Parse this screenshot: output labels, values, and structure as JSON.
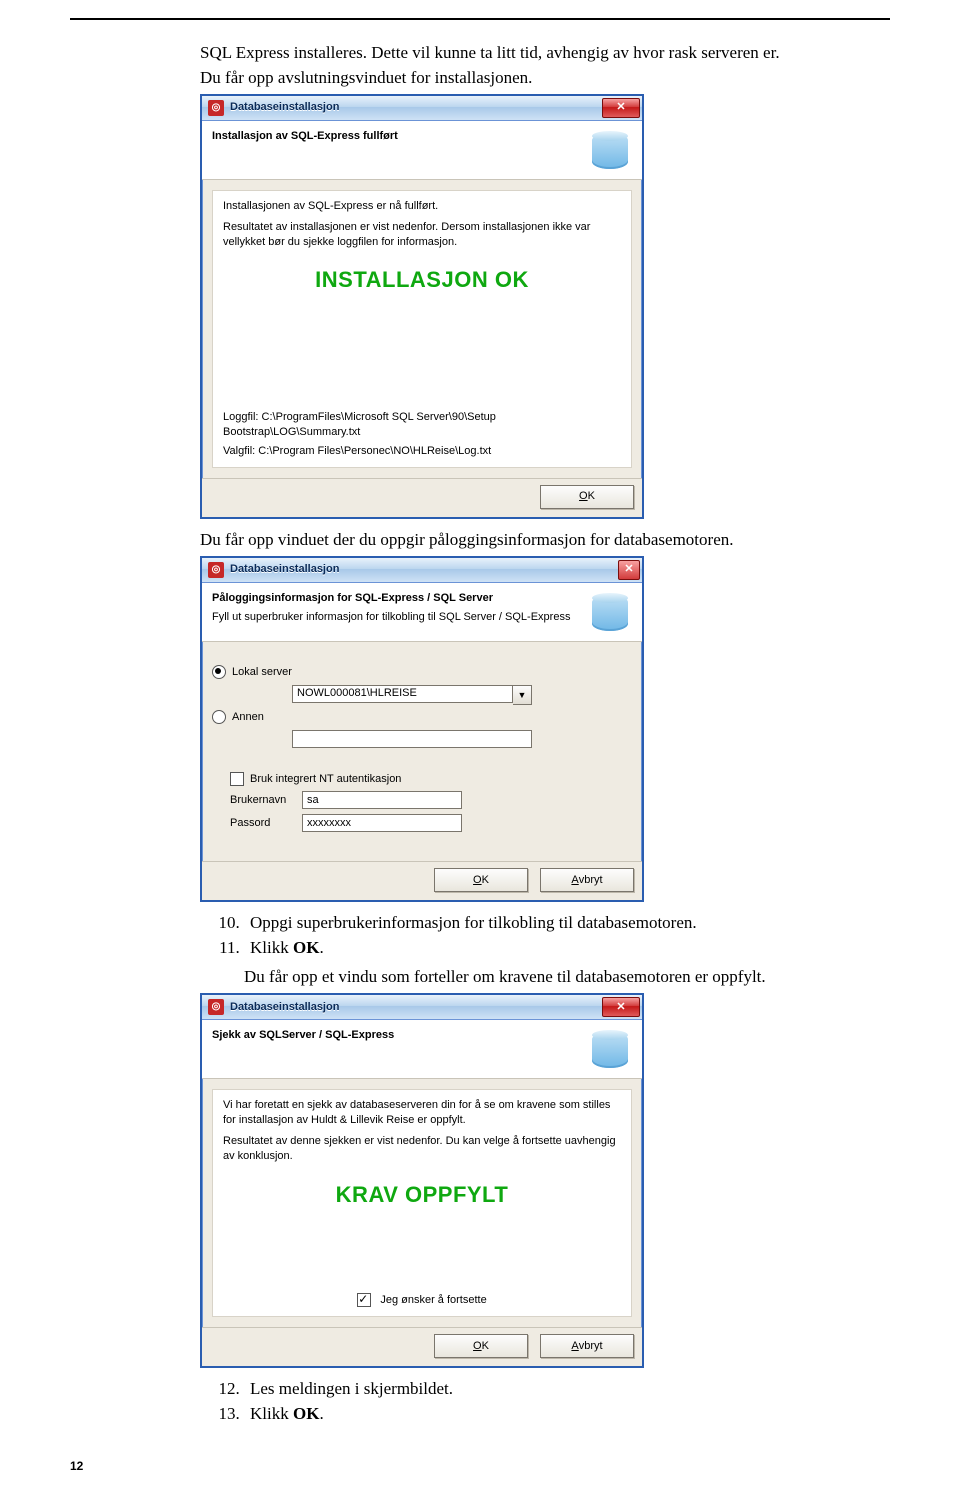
{
  "doc": {
    "intro_line1": "SQL Express installeres. Dette vil kunne ta litt tid, avhengig av hvor rask serveren er.",
    "intro_line2": "Du får opp avslutningsvinduet for installasjonen.",
    "after_win1": "Du får opp vinduet der du oppgir påloggingsinformasjon for databasemotoren.",
    "step10": "Oppgi superbrukerinformasjon for tilkobling til databasemotoren.",
    "step11_a": "Klikk ",
    "step11_b": "OK",
    "step11_c": ".",
    "after_steps": "Du får opp et vindu som forteller om kravene til databasemotoren er oppfylt.",
    "step12": "Les meldingen i skjermbildet.",
    "step13_a": "Klikk ",
    "step13_b": "OK",
    "step13_c": ".",
    "page_number": "12"
  },
  "win1": {
    "title": "Databaseinstallasjon",
    "heading": "Installasjon av SQL-Express fullført",
    "line1": "Installasjonen av SQL-Express er nå fullført.",
    "line2": "Resultatet av installasjonen er vist nedenfor. Dersom installasjonen ikke var vellykket bør du sjekke loggfilen for informasjon.",
    "banner": "INSTALLASJON OK",
    "logg_label": "Loggfil:",
    "logg_path": "C:\\ProgramFiles\\Microsoft SQL Server\\90\\Setup Bootstrap\\LOG\\Summary.txt",
    "valg_label": "Valgfil:",
    "valg_path": "C:\\Program Files\\Personec\\NO\\HLReise\\Log.txt",
    "ok": "OK"
  },
  "win2": {
    "title": "Databaseinstallasjon",
    "heading": "Påloggingsinformasjon for SQL-Express / SQL Server",
    "sub": "Fyll ut superbruker informasjon for tilkobling til SQL Server / SQL-Express",
    "opt_local": "Lokal server",
    "local_value": "NOWL000081\\HLREISE",
    "opt_other": "Annen",
    "nt_auth": "Bruk integrert NT autentikasjon",
    "user_label": "Brukernavn",
    "user_value": "sa",
    "pass_label": "Passord",
    "pass_value": "xxxxxxxx",
    "ok": "OK",
    "cancel": "Avbryt"
  },
  "win3": {
    "title": "Databaseinstallasjon",
    "heading": "Sjekk av SQLServer / SQL-Express",
    "line1": "Vi har foretatt en sjekk av databaseserveren din for å se om kravene som stilles for installasjon av Huldt & Lillevik Reise er oppfylt.",
    "line2": "Resultatet av denne sjekken er vist nedenfor. Du kan velge å fortsette uavhengig av konklusjon.",
    "banner": "KRAV OPPFYLT",
    "continue": "Jeg ønsker å fortsette",
    "ok": "OK",
    "cancel": "Avbryt"
  }
}
